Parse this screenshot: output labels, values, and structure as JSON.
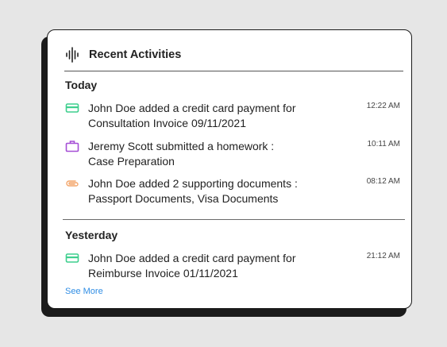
{
  "widget": {
    "title": "Recent Activities",
    "header_icon": "sound-wave-icon"
  },
  "sections": [
    {
      "title": "Today",
      "items": [
        {
          "line1": "John Doe added a credit card payment for",
          "line2": "Consultation Invoice 09/11/2021",
          "time": "12:22 AM",
          "icon": "credit-card-icon",
          "icon_color": "#3ecf8e"
        },
        {
          "line1": "Jeremy Scott submitted a homework :",
          "line2": "Case Preparation",
          "time": "10:11 AM",
          "icon": "briefcase-icon",
          "icon_color": "#a54fd6"
        },
        {
          "line1": "John Doe added 2 supporting documents :",
          "line2": "Passport Documents, Visa Documents",
          "time": "08:12 AM",
          "icon": "paperclip-icon",
          "icon_color": "#f3a66b"
        }
      ]
    },
    {
      "title": "Yesterday",
      "items": [
        {
          "line1": "John Doe added a credit card payment for",
          "line2": "Reimburse Invoice 01/11/2021",
          "time": "21:12 AM",
          "icon": "credit-card-icon",
          "icon_color": "#3ecf8e"
        }
      ]
    }
  ],
  "see_more_label": "See More",
  "colors": {
    "link": "#2f8de4",
    "card_border": "#1b1b1b",
    "shadow": "#1b1b1b",
    "background": "#e6e6e6"
  }
}
